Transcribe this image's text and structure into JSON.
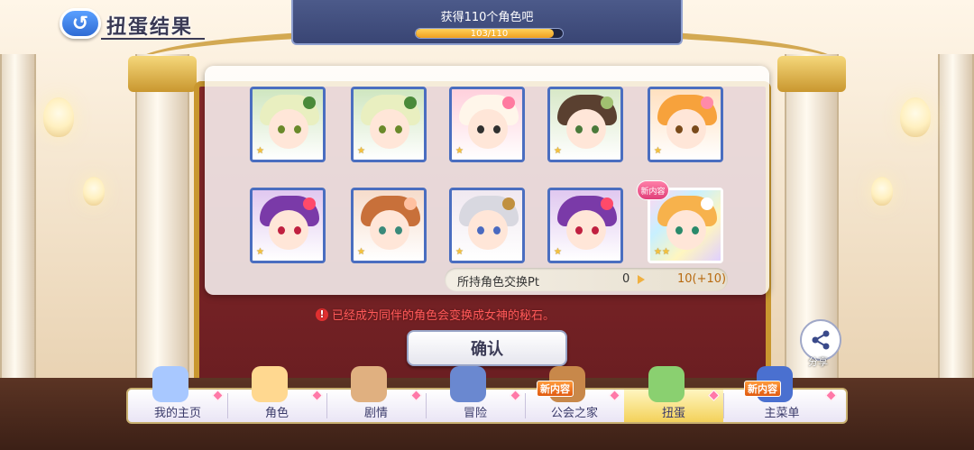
{
  "header": {
    "back_icon": "back-arrow-icon",
    "title": "扭蛋结果"
  },
  "banner": {
    "text": "获得110个角色吧",
    "progress_text": "103/110",
    "progress_value": 103,
    "progress_max": 110
  },
  "results": {
    "cards": [
      {
        "name": "character-1",
        "stars": "★",
        "hair": "#e9efc0",
        "accent": "#4a8a3a",
        "bg": "#cfe6c0",
        "eye": "#6a8a2a"
      },
      {
        "name": "character-2",
        "stars": "★",
        "hair": "#e9efc0",
        "accent": "#4a8a3a",
        "bg": "#cfe6c0",
        "eye": "#6a8a2a"
      },
      {
        "name": "character-3",
        "stars": "★",
        "hair": "#fff6ea",
        "accent": "#ff7aa0",
        "bg": "#ffd0dc",
        "eye": "#303030"
      },
      {
        "name": "character-4",
        "stars": "★",
        "hair": "#5a4030",
        "accent": "#a0c070",
        "bg": "#d8e8c8",
        "eye": "#4a7a3a"
      },
      {
        "name": "character-5",
        "stars": "★",
        "hair": "#f7a23c",
        "accent": "#ff8aa8",
        "bg": "#ffe0c0",
        "eye": "#7a4a1a"
      },
      {
        "name": "character-6",
        "stars": "★",
        "hair": "#7a3aa8",
        "accent": "#ff4a6a",
        "bg": "#e0c8f0",
        "eye": "#c02040"
      },
      {
        "name": "character-7",
        "stars": "★",
        "hair": "#c8703a",
        "accent": "#ffc0a0",
        "bg": "#f6dccb",
        "eye": "#3a8a7a"
      },
      {
        "name": "character-8",
        "stars": "★",
        "hair": "#d8d8e0",
        "accent": "#c09040",
        "bg": "#f0e8f0",
        "eye": "#4a6ac0"
      },
      {
        "name": "character-9",
        "stars": "★",
        "hair": "#7a3aa8",
        "accent": "#ff4a6a",
        "bg": "#e0c8f0",
        "eye": "#c02040"
      },
      {
        "name": "character-10",
        "stars": "★★",
        "hair": "#f7b24c",
        "accent": "#ffffff",
        "bg": "#f8e6ff",
        "eye": "#2a8a6a",
        "is_new": true
      }
    ],
    "new_badge": "新内容"
  },
  "pt": {
    "label": "所持角色交换Pt",
    "current": "0",
    "after": "10(+10)"
  },
  "notice": {
    "icon": "!",
    "text": "已经成为同伴的角色会变换成女神的秘石。"
  },
  "confirm_label": "确认",
  "share_label": "分享",
  "nav": {
    "items": [
      {
        "label": "我的主页",
        "new": ""
      },
      {
        "label": "角色",
        "new": ""
      },
      {
        "label": "剧情",
        "new": ""
      },
      {
        "label": "冒险",
        "new": ""
      },
      {
        "label": "公会之家",
        "new": "新内容"
      },
      {
        "label": "扭蛋",
        "new": "",
        "active": true
      },
      {
        "label": "主菜单",
        "new": "新内容"
      }
    ]
  }
}
